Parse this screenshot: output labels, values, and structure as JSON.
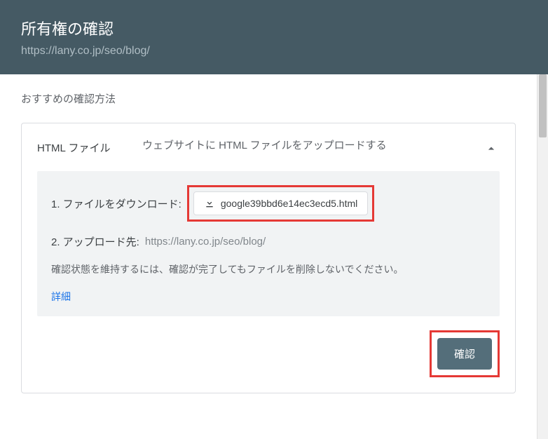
{
  "header": {
    "title": "所有権の確認",
    "url": "https://lany.co.jp/seo/blog/"
  },
  "section_label": "おすすめの確認方法",
  "card": {
    "method_name": "HTML ファイル",
    "description": "ウェブサイトに HTML ファイルをアップロードする",
    "step1_label": "1. ファイルをダウンロード:",
    "download_filename": "google39bbd6e14ec3ecd5.html",
    "step2_label": "2. アップロード先:",
    "step2_url": "https://lany.co.jp/seo/blog/",
    "note": "確認状態を維持するには、確認が完了してもファイルを削除しないでください。",
    "detail_link": "詳細",
    "verify_button": "確認"
  }
}
